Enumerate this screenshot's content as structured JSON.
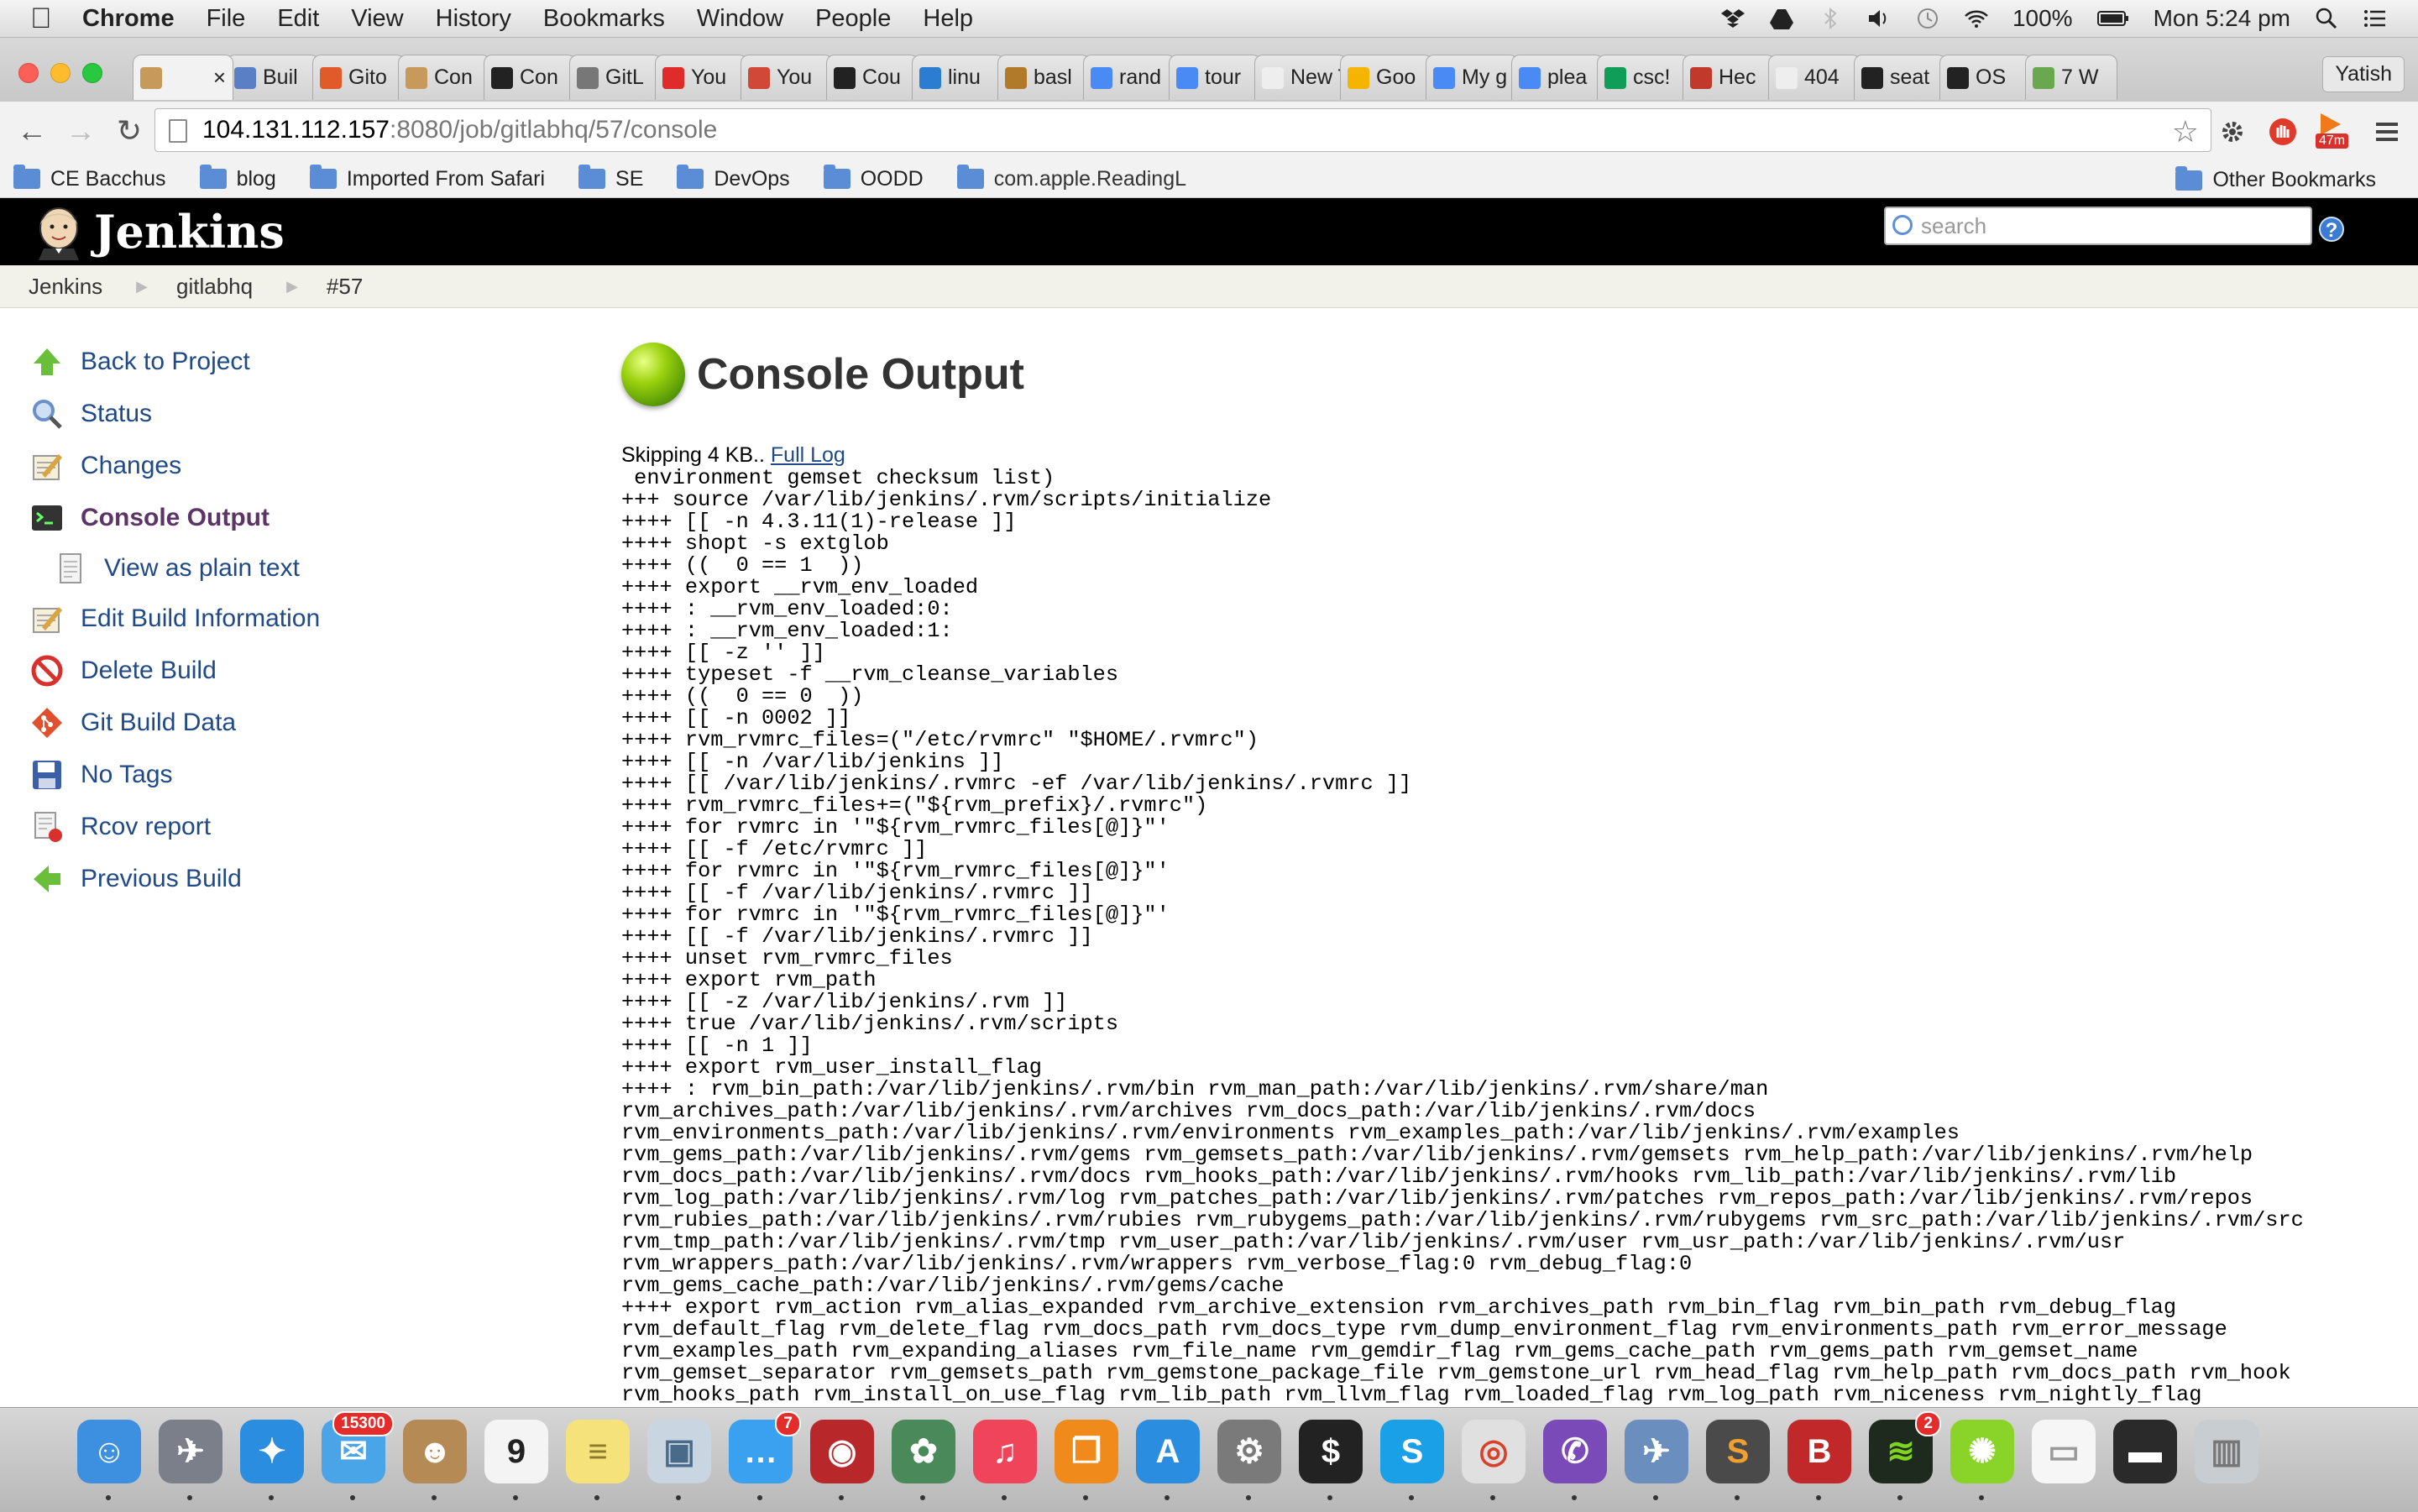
{
  "menubar": {
    "app": "Chrome",
    "menus": [
      "File",
      "Edit",
      "View",
      "History",
      "Bookmarks",
      "Window",
      "People",
      "Help"
    ],
    "battery": "100%",
    "clock": "Mon 5:24 pm"
  },
  "tabs": [
    {
      "label": "",
      "color": "#c79a5b",
      "active": true
    },
    {
      "label": "Buil",
      "color": "#5a7fc5"
    },
    {
      "label": "Gito",
      "color": "#e05a2a"
    },
    {
      "label": "Con",
      "color": "#c79a5b"
    },
    {
      "label": "Con",
      "color": "#222222"
    },
    {
      "label": "GitL",
      "color": "#777777"
    },
    {
      "label": "You",
      "color": "#e02b2b"
    },
    {
      "label": "You",
      "color": "#d14836"
    },
    {
      "label": "Cou",
      "color": "#222222"
    },
    {
      "label": "linu",
      "color": "#2a7dd1"
    },
    {
      "label": "basl",
      "color": "#b07a2a"
    },
    {
      "label": "rand",
      "color": "#4a8af4"
    },
    {
      "label": "tour",
      "color": "#4a8af4"
    },
    {
      "label": "New Ta",
      "color": "#eeeeee"
    },
    {
      "label": "Goo",
      "color": "#f4b400"
    },
    {
      "label": "My g",
      "color": "#4a8af4"
    },
    {
      "label": "plea",
      "color": "#4a8af4"
    },
    {
      "label": "csc!",
      "color": "#0f9d58"
    },
    {
      "label": "Hec",
      "color": "#c0392b"
    },
    {
      "label": "404",
      "color": "#eeeeee"
    },
    {
      "label": "seat",
      "color": "#222222"
    },
    {
      "label": "OS",
      "color": "#222222"
    },
    {
      "label": "7 W",
      "color": "#6aa84f"
    }
  ],
  "profile_name": "Yatish",
  "address": {
    "host": "104.131.112.157",
    "path": ":8080/job/gitlabhq/57/console"
  },
  "extension_badge": "47m",
  "bookmarks": [
    "CE Bacchus",
    "blog",
    "Imported From Safari",
    "SE",
    "DevOps",
    "OODD",
    "com.apple.ReadingL"
  ],
  "other_bookmarks": "Other Bookmarks",
  "jenkins": {
    "title": "Jenkins",
    "search_placeholder": "search",
    "help": "?"
  },
  "breadcrumbs": [
    "Jenkins",
    "gitlabhq",
    "#57"
  ],
  "sidebar": [
    {
      "label": "Back to Project",
      "icon": "up-arrow-icon",
      "color": "#6abf3a"
    },
    {
      "label": "Status",
      "icon": "magnifier-icon",
      "color": "#6b8fc9"
    },
    {
      "label": "Changes",
      "icon": "notepad-icon",
      "color": "#d9a441"
    },
    {
      "label": "Console Output",
      "icon": "terminal-icon",
      "color": "#333333",
      "active": true
    },
    {
      "label": "View as plain text",
      "icon": "document-icon",
      "color": "#dddddd",
      "sub": true
    },
    {
      "label": "Edit Build Information",
      "icon": "notepad-icon",
      "color": "#d9a441"
    },
    {
      "label": "Delete Build",
      "icon": "no-entry-icon",
      "color": "#d9302c"
    },
    {
      "label": "Git Build Data",
      "icon": "git-icon",
      "color": "#e0502c"
    },
    {
      "label": "No Tags",
      "icon": "save-icon",
      "color": "#3b5fa8"
    },
    {
      "label": "Rcov report",
      "icon": "report-icon",
      "color": "#999999"
    },
    {
      "label": "Previous Build",
      "icon": "left-arrow-icon",
      "color": "#6abf3a"
    }
  ],
  "main": {
    "title": "Console Output",
    "skip_text": "Skipping 4 KB..",
    "full_log": "Full Log",
    "console": " environment gemset checksum list)\n+++ source /var/lib/jenkins/.rvm/scripts/initialize\n++++ [[ -n 4.3.11(1)-release ]]\n++++ shopt -s extglob\n++++ ((  0 == 1  ))\n++++ export __rvm_env_loaded\n++++ : __rvm_env_loaded:0:\n++++ : __rvm_env_loaded:1:\n++++ [[ -z '' ]]\n++++ typeset -f __rvm_cleanse_variables\n++++ ((  0 == 0  ))\n++++ [[ -n 0002 ]]\n++++ rvm_rvmrc_files=(\"/etc/rvmrc\" \"$HOME/.rvmrc\")\n++++ [[ -n /var/lib/jenkins ]]\n++++ [[ /var/lib/jenkins/.rvmrc -ef /var/lib/jenkins/.rvmrc ]]\n++++ rvm_rvmrc_files+=(\"${rvm_prefix}/.rvmrc\")\n++++ for rvmrc in '\"${rvm_rvmrc_files[@]}\"'\n++++ [[ -f /etc/rvmrc ]]\n++++ for rvmrc in '\"${rvm_rvmrc_files[@]}\"'\n++++ [[ -f /var/lib/jenkins/.rvmrc ]]\n++++ for rvmrc in '\"${rvm_rvmrc_files[@]}\"'\n++++ [[ -f /var/lib/jenkins/.rvmrc ]]\n++++ unset rvm_rvmrc_files\n++++ export rvm_path\n++++ [[ -z /var/lib/jenkins/.rvm ]]\n++++ true /var/lib/jenkins/.rvm/scripts\n++++ [[ -n 1 ]]\n++++ export rvm_user_install_flag\n++++ : rvm_bin_path:/var/lib/jenkins/.rvm/bin rvm_man_path:/var/lib/jenkins/.rvm/share/man\nrvm_archives_path:/var/lib/jenkins/.rvm/archives rvm_docs_path:/var/lib/jenkins/.rvm/docs\nrvm_environments_path:/var/lib/jenkins/.rvm/environments rvm_examples_path:/var/lib/jenkins/.rvm/examples\nrvm_gems_path:/var/lib/jenkins/.rvm/gems rvm_gemsets_path:/var/lib/jenkins/.rvm/gemsets rvm_help_path:/var/lib/jenkins/.rvm/help\nrvm_docs_path:/var/lib/jenkins/.rvm/docs rvm_hooks_path:/var/lib/jenkins/.rvm/hooks rvm_lib_path:/var/lib/jenkins/.rvm/lib\nrvm_log_path:/var/lib/jenkins/.rvm/log rvm_patches_path:/var/lib/jenkins/.rvm/patches rvm_repos_path:/var/lib/jenkins/.rvm/repos\nrvm_rubies_path:/var/lib/jenkins/.rvm/rubies rvm_rubygems_path:/var/lib/jenkins/.rvm/rubygems rvm_src_path:/var/lib/jenkins/.rvm/src\nrvm_tmp_path:/var/lib/jenkins/.rvm/tmp rvm_user_path:/var/lib/jenkins/.rvm/user rvm_usr_path:/var/lib/jenkins/.rvm/usr\nrvm_wrappers_path:/var/lib/jenkins/.rvm/wrappers rvm_verbose_flag:0 rvm_debug_flag:0\nrvm_gems_cache_path:/var/lib/jenkins/.rvm/gems/cache\n++++ export rvm_action rvm_alias_expanded rvm_archive_extension rvm_archives_path rvm_bin_flag rvm_bin_path rvm_debug_flag\nrvm_default_flag rvm_delete_flag rvm_docs_path rvm_docs_type rvm_dump_environment_flag rvm_environments_path rvm_error_message\nrvm_examples_path rvm_expanding_aliases rvm_file_name rvm_gemdir_flag rvm_gems_cache_path rvm_gems_path rvm_gemset_name\nrvm_gemset_separator rvm_gemsets_path rvm_gemstone_package_file rvm_gemstone_url rvm_head_flag rvm_help_path rvm_docs_path rvm_hook\nrvm_hooks_path rvm_install_on_use_flag rvm_lib_path rvm_llvm_flag rvm_loaded_flag rvm_log_path rvm_niceness rvm_nightly_flag"
  },
  "dock": [
    {
      "name": "finder-icon",
      "color": "#3d8fe0",
      "glyph": "☺"
    },
    {
      "name": "launchpad-icon",
      "color": "#7a7f8a",
      "glyph": "✈"
    },
    {
      "name": "safari-icon",
      "color": "#2a8de0",
      "glyph": "✦"
    },
    {
      "name": "mail-icon",
      "color": "#4aa4e8",
      "glyph": "✉",
      "badge": "15300"
    },
    {
      "name": "contacts-icon",
      "color": "#b58a55",
      "glyph": "☻"
    },
    {
      "name": "calendar-icon",
      "color": "#f4f4f4",
      "glyph": "9",
      "text": "#222"
    },
    {
      "name": "notes-icon",
      "color": "#f6e27a",
      "glyph": "≡",
      "text": "#8a7a2a"
    },
    {
      "name": "preview-icon",
      "color": "#c9d6e2",
      "glyph": "▣",
      "text": "#4a6a8a"
    },
    {
      "name": "messages-icon",
      "color": "#3aa0f0",
      "glyph": "…",
      "badge": "7"
    },
    {
      "name": "photo-booth-icon",
      "color": "#b8282a",
      "glyph": "◉"
    },
    {
      "name": "iphoto-icon",
      "color": "#4a8a5a",
      "glyph": "✿"
    },
    {
      "name": "itunes-icon",
      "color": "#f0445a",
      "glyph": "♫"
    },
    {
      "name": "ibooks-icon",
      "color": "#f08a1a",
      "glyph": "❐"
    },
    {
      "name": "app-store-icon",
      "color": "#2a8de0",
      "glyph": "A"
    },
    {
      "name": "system-preferences-icon",
      "color": "#7a7a7a",
      "glyph": "⚙"
    },
    {
      "name": "terminal-icon",
      "color": "#222222",
      "glyph": "$"
    },
    {
      "name": "skype-icon",
      "color": "#1aa0e6",
      "glyph": "S"
    },
    {
      "name": "chrome-icon",
      "color": "#e0e0e0",
      "glyph": "◎",
      "text": "#d9402a"
    },
    {
      "name": "viber-icon",
      "color": "#7a4ab8",
      "glyph": "✆"
    },
    {
      "name": "preview-eagle-icon",
      "color": "#6a8fbf",
      "glyph": "✈"
    },
    {
      "name": "sublime-text-icon",
      "color": "#4a4a4a",
      "glyph": "S",
      "text": "#f0a030"
    },
    {
      "name": "bitdefender-icon",
      "color": "#c0282a",
      "glyph": "B"
    },
    {
      "name": "spotify-icon",
      "color": "#1e2a1e",
      "glyph": "≋",
      "text": "#7ed321",
      "badge": "2"
    },
    {
      "name": "limewire-icon",
      "color": "#8ad42a",
      "glyph": "✺"
    },
    {
      "name": "document-stack-icon",
      "color": "#f6f6f6",
      "glyph": "▭",
      "text": "#999"
    },
    {
      "name": "terminal-window-icon",
      "color": "#2a2a2a",
      "glyph": "▬"
    },
    {
      "name": "trash-icon",
      "color": "#c8cdd2",
      "glyph": "▥",
      "text": "#777"
    }
  ]
}
